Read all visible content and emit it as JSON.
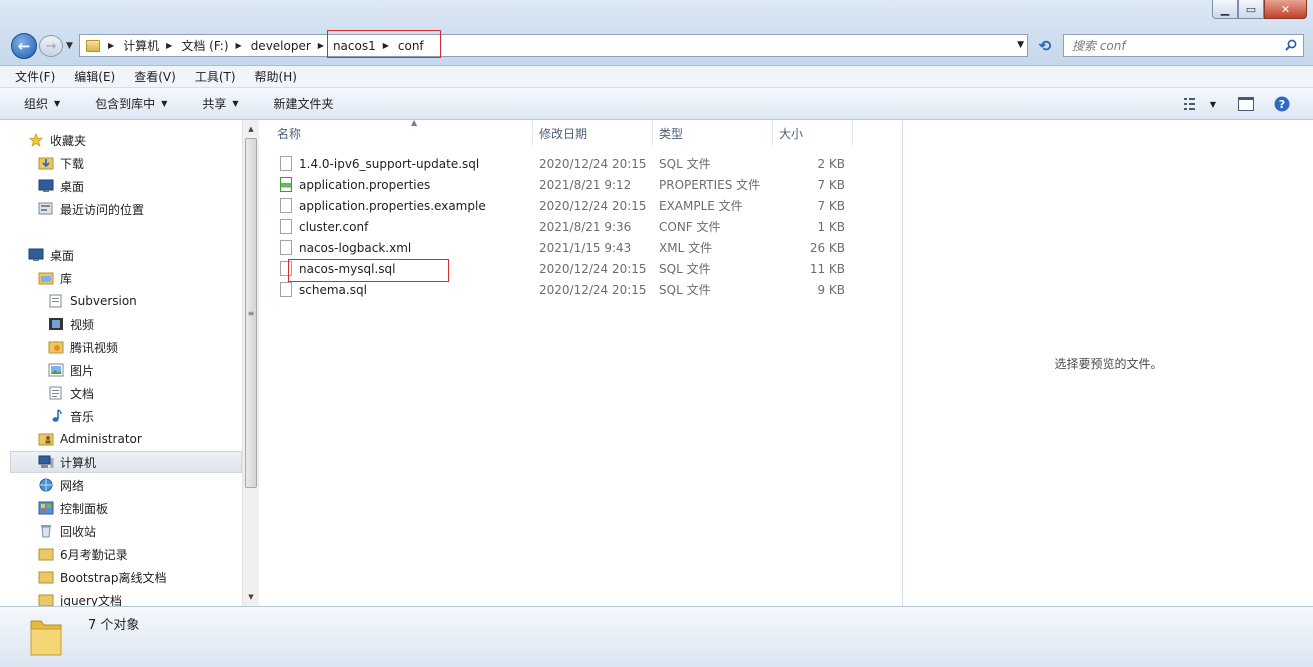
{
  "window": {
    "min_glyph": "▁",
    "max_glyph": "▭",
    "close_glyph": "✕"
  },
  "address": {
    "back_glyph": "←",
    "forward_glyph": "→",
    "breadcrumb": [
      "计算机",
      "文档 (F:)",
      "developer",
      "nacos1",
      "conf"
    ],
    "search_placeholder": "搜索 conf"
  },
  "menu": [
    "文件(F)",
    "编辑(E)",
    "查看(V)",
    "工具(T)",
    "帮助(H)"
  ],
  "toolbar": {
    "organize": "组织",
    "include_library": "包含到库中",
    "share": "共享",
    "new_folder": "新建文件夹"
  },
  "nav": {
    "favorites": "收藏夹",
    "downloads": "下载",
    "desktop_fav": "桌面",
    "recent": "最近访问的位置",
    "desktop": "桌面",
    "libraries": "库",
    "subversion": "Subversion",
    "videos": "视频",
    "tencent_video": "腾讯视频",
    "pictures": "图片",
    "documents": "文档",
    "music": "音乐",
    "administrator": "Administrator",
    "computer": "计算机",
    "network": "网络",
    "control_panel": "控制面板",
    "recycle_bin": "回收站",
    "attendance": "6月考勤记录",
    "bootstrap": "Bootstrap离线文档",
    "jquery": "jquery文档"
  },
  "columns": {
    "name": "名称",
    "date": "修改日期",
    "type": "类型",
    "size": "大小"
  },
  "files": [
    {
      "name": "1.4.0-ipv6_support-update.sql",
      "date": "2020/12/24 20:15",
      "type": "SQL 文件",
      "size": "2 KB"
    },
    {
      "name": "application.properties",
      "date": "2021/8/21 9:12",
      "type": "PROPERTIES 文件",
      "size": "7 KB"
    },
    {
      "name": "application.properties.example",
      "date": "2020/12/24 20:15",
      "type": "EXAMPLE 文件",
      "size": "7 KB"
    },
    {
      "name": "cluster.conf",
      "date": "2021/8/21 9:36",
      "type": "CONF 文件",
      "size": "1 KB"
    },
    {
      "name": "nacos-logback.xml",
      "date": "2021/1/15 9:43",
      "type": "XML 文件",
      "size": "26 KB"
    },
    {
      "name": "nacos-mysql.sql",
      "date": "2020/12/24 20:15",
      "type": "SQL 文件",
      "size": "11 KB"
    },
    {
      "name": "schema.sql",
      "date": "2020/12/24 20:15",
      "type": "SQL 文件",
      "size": "9 KB"
    }
  ],
  "preview": {
    "empty_text": "选择要预览的文件。"
  },
  "status": {
    "item_count": "7 个对象"
  },
  "colors": {
    "highlight": "#d92b2b",
    "selection": "#dfe4ea"
  }
}
